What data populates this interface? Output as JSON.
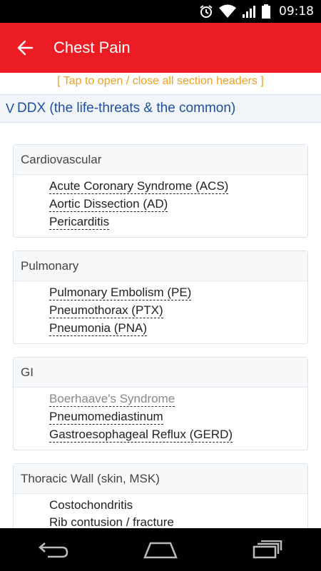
{
  "status_bar": {
    "time": "09:18",
    "icons": [
      "alarm-icon",
      "wifi-icon",
      "signal-icon",
      "battery-icon"
    ]
  },
  "app_bar": {
    "title": "Chest Pain",
    "color": "#ec1c24"
  },
  "content": {
    "tap_hint": "[ Tap to open / close all section headers ]",
    "section": {
      "chevron": "V",
      "title": "DDX (the life-threats & the common)"
    },
    "cards": [
      {
        "title": "Cardiovascular",
        "items": [
          {
            "label": "Acute Coronary Syndrome (ACS)",
            "linked": true,
            "muted": false
          },
          {
            "label": "Aortic Dissection (AD)",
            "linked": true,
            "muted": false
          },
          {
            "label": "Pericarditis",
            "linked": true,
            "muted": false
          }
        ]
      },
      {
        "title": "Pulmonary",
        "items": [
          {
            "label": "Pulmonary Embolism (PE)",
            "linked": true,
            "muted": false
          },
          {
            "label": "Pneumothorax (PTX)",
            "linked": true,
            "muted": false
          },
          {
            "label": "Pneumonia (PNA)",
            "linked": true,
            "muted": false
          }
        ]
      },
      {
        "title": "GI",
        "items": [
          {
            "label": "Boerhaave's Syndrome",
            "linked": true,
            "muted": true
          },
          {
            "label": "Pneumomediastinum",
            "linked": true,
            "muted": false
          },
          {
            "label": "Gastroesophageal Reflux (GERD)",
            "linked": true,
            "muted": false
          }
        ]
      },
      {
        "title": "Thoracic Wall (skin, MSK)",
        "items": [
          {
            "label": "Costochondritis",
            "linked": false,
            "muted": false
          },
          {
            "label": "Rib contusion / fracture",
            "linked": false,
            "muted": false
          }
        ]
      }
    ]
  },
  "nav_bar": {
    "buttons": [
      "back-icon",
      "home-icon",
      "recents-icon"
    ]
  }
}
